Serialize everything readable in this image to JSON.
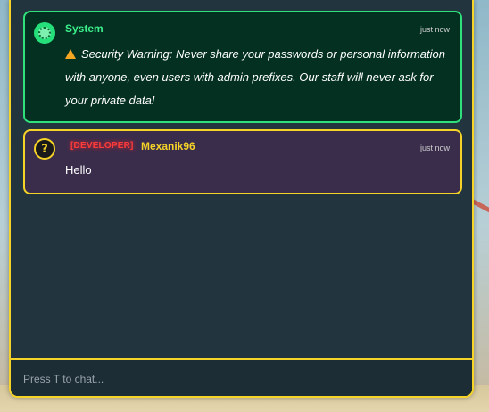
{
  "messages": [
    {
      "sender": "System",
      "time": "just now",
      "text": "Security Warning: Never share your passwords or personal information with anyone, even users with admin prefixes. Our staff will never ask for your private data!",
      "icon": "warning-icon"
    },
    {
      "tag": "[DEVELOPER]",
      "sender": "Mexanik96",
      "time": "just now",
      "text": "Hello",
      "avatar_glyph": "?"
    }
  ],
  "input": {
    "placeholder": "Press T to chat..."
  },
  "colors": {
    "panel_border": "#f5d327",
    "system_border": "#2fe07b",
    "system_name": "#3cf18c",
    "developer_tag": "#ff3b3b"
  }
}
